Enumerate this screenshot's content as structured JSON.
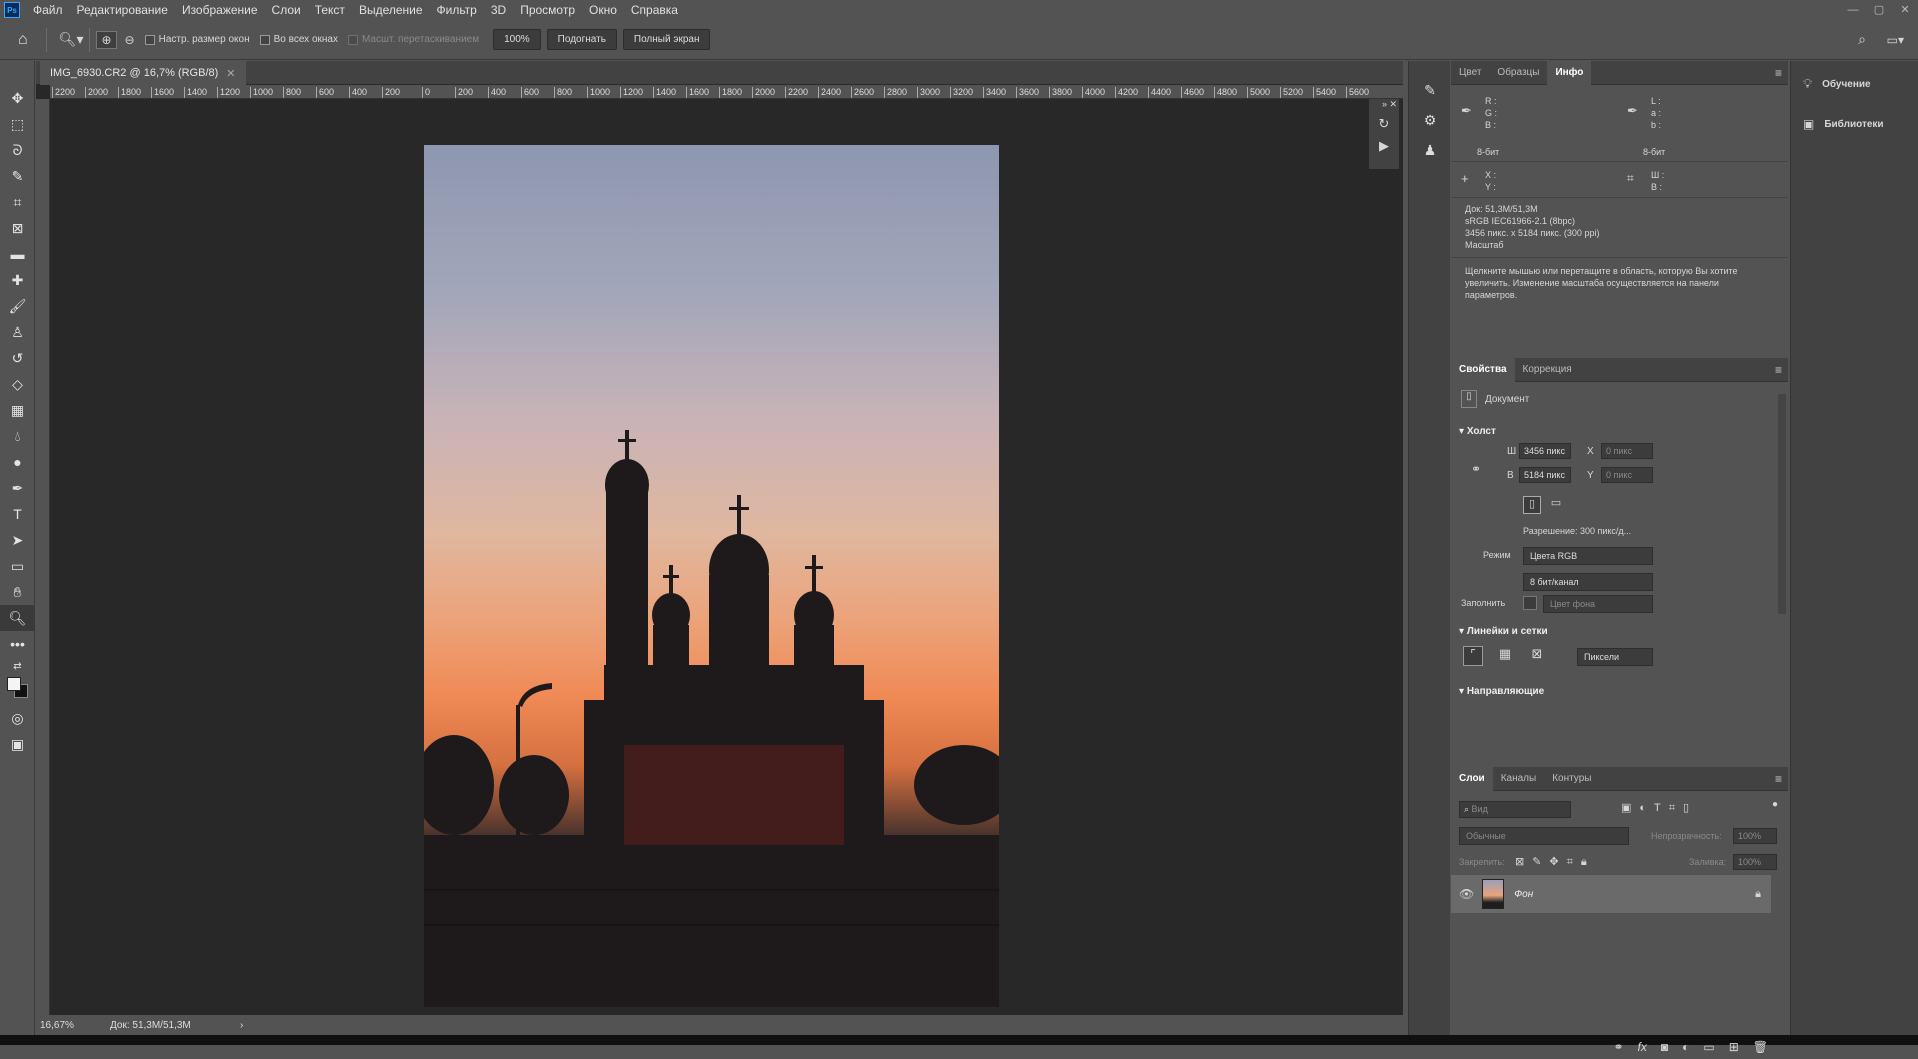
{
  "app": {
    "logo": "Ps"
  },
  "menu": [
    "Файл",
    "Редактирование",
    "Изображение",
    "Слои",
    "Текст",
    "Выделение",
    "Фильтр",
    "3D",
    "Просмотр",
    "Окно",
    "Справка"
  ],
  "window_controls": [
    "—",
    "▢",
    "✕"
  ],
  "options": {
    "resize_windows": "Настр. размер окон",
    "all_windows": "Во всех окнах",
    "scrubby_zoom": "Масшт. перетаскиванием",
    "zoom_value": "100%",
    "fit_button": "Подогнать",
    "fullscreen_button": "Полный экран"
  },
  "document": {
    "tab_title": "IMG_6930.CR2 @ 16,7% (RGB/8)",
    "ruler_ticks": [
      "2200",
      "2000",
      "1800",
      "1600",
      "1400",
      "1200",
      "1000",
      "800",
      "600",
      "400",
      "200",
      "0",
      "200",
      "400",
      "600",
      "800",
      "1000",
      "1200",
      "1400",
      "1600",
      "1800",
      "2000",
      "2200",
      "2400",
      "2600",
      "2800",
      "3000",
      "3200",
      "3400",
      "3600",
      "3800",
      "4000",
      "4200",
      "4400",
      "4600",
      "4800",
      "5000",
      "5200",
      "5400",
      "5600"
    ]
  },
  "status": {
    "zoom": "16,67%",
    "doc": "Док: 51,3M/51,3M",
    "arrow": "›"
  },
  "info_panel": {
    "tabs": [
      "Цвет",
      "Образцы",
      "Инфо"
    ],
    "rgb_labels": "R :\nG :\nB :",
    "lab_labels": "L :\na :\nb :",
    "bit1": "8-бит",
    "bit2": "8-бит",
    "xy_labels": "X :\nY :",
    "wh_labels": "Ш :\nВ :",
    "doc_info": [
      "Док: 51,3M/51,3M",
      "sRGB IEC61966-2.1 (8bpc)",
      "3456 пикс. x 5184 пикс. (300 ppi)",
      "Масштаб"
    ],
    "hint": "Щелкните мышью или перетащите в область, которую Вы хотите увеличить. Изменение масштаба осуществляется на панели параметров."
  },
  "properties": {
    "tabs": [
      "Свойства",
      "Коррекция"
    ],
    "doc_label": "Документ",
    "canvas_header": "Холст",
    "w_label": "Ш",
    "w_value": "3456 пикс",
    "h_label": "В",
    "h_value": "5184 пикс",
    "x_label": "X",
    "x_value": "0 пикс",
    "y_label": "Y",
    "y_value": "0 пикс",
    "resolution": "Разрешение: 300 пикс/д...",
    "mode_label": "Режим",
    "mode_value": "Цвета RGB",
    "depth_value": "8 бит/канал",
    "fill_label": "Заполнить",
    "fill_value": "Цвет фона",
    "rulers_header": "Линейки и сетки",
    "units_value": "Пиксели",
    "guides_header": "Направляющие"
  },
  "layers": {
    "tabs": [
      "Слои",
      "Каналы",
      "Контуры"
    ],
    "search_placeholder": "Вид",
    "blend_mode": "Обычные",
    "opacity_label": "Непрозрачность:",
    "opacity_value": "100%",
    "lock_label": "Закрепить:",
    "fill_label": "Заливка:",
    "fill_value": "100%",
    "layer_name": "Фон"
  },
  "far_right": {
    "learn": "Обучение",
    "libraries": "Библиотеки"
  }
}
